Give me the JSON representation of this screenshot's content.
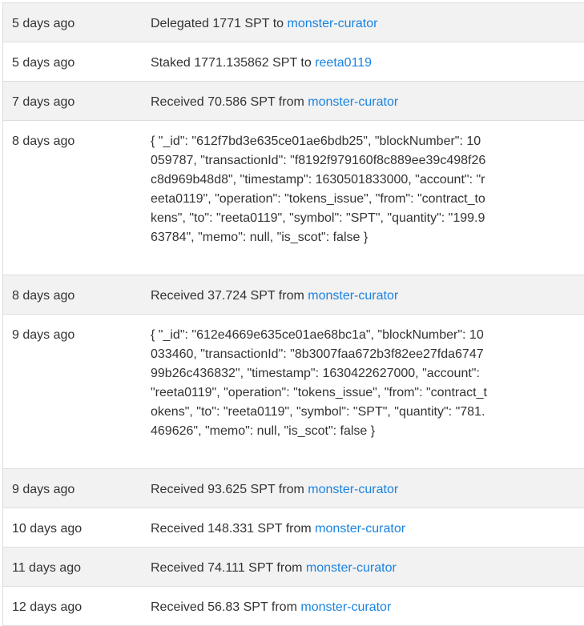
{
  "rows": [
    {
      "time": "5 days ago",
      "pre": "Delegated 1771 SPT to ",
      "link": "monster-curator"
    },
    {
      "time": "5 days ago",
      "pre": "Staked 1771.135862 SPT to ",
      "link": "reeta0119"
    },
    {
      "time": "7 days ago",
      "pre": "Received 70.586 SPT from ",
      "link": "monster-curator"
    },
    {
      "time": "8 days ago",
      "json": "{ \"_id\": \"612f7bd3e635ce01ae6bdb25\", \"blockNumber\": 10059787, \"transactionId\": \"f8192f979160f8c889ee39c498f26c8d969b48d8\", \"timestamp\": 1630501833000, \"account\": \"reeta0119\", \"operation\": \"tokens_issue\", \"from\": \"contract_tokens\", \"to\": \"reeta0119\", \"symbol\": \"SPT\", \"quantity\": \"199.963784\", \"memo\": null, \"is_scot\": false }"
    },
    {
      "time": "8 days ago",
      "pre": "Received 37.724 SPT from ",
      "link": "monster-curator"
    },
    {
      "time": "9 days ago",
      "json": "{ \"_id\": \"612e4669e635ce01ae68bc1a\", \"blockNumber\": 10033460, \"transactionId\": \"8b3007faa672b3f82ee27fda674799b26c436832\", \"timestamp\": 1630422627000, \"account\": \"reeta0119\", \"operation\": \"tokens_issue\", \"from\": \"contract_tokens\", \"to\": \"reeta0119\", \"symbol\": \"SPT\", \"quantity\": \"781.469626\", \"memo\": null, \"is_scot\": false }"
    },
    {
      "time": "9 days ago",
      "pre": "Received 93.625 SPT from ",
      "link": "monster-curator"
    },
    {
      "time": "10 days ago",
      "pre": "Received 148.331 SPT from ",
      "link": "monster-curator"
    },
    {
      "time": "11 days ago",
      "pre": "Received 74.111 SPT from ",
      "link": "monster-curator"
    },
    {
      "time": "12 days ago",
      "pre": "Received 56.83 SPT from ",
      "link": "monster-curator"
    }
  ],
  "colors": {
    "link": "#1a83e0",
    "stripe": "#f2f2f2",
    "border": "#dddddd",
    "text": "#333333"
  }
}
